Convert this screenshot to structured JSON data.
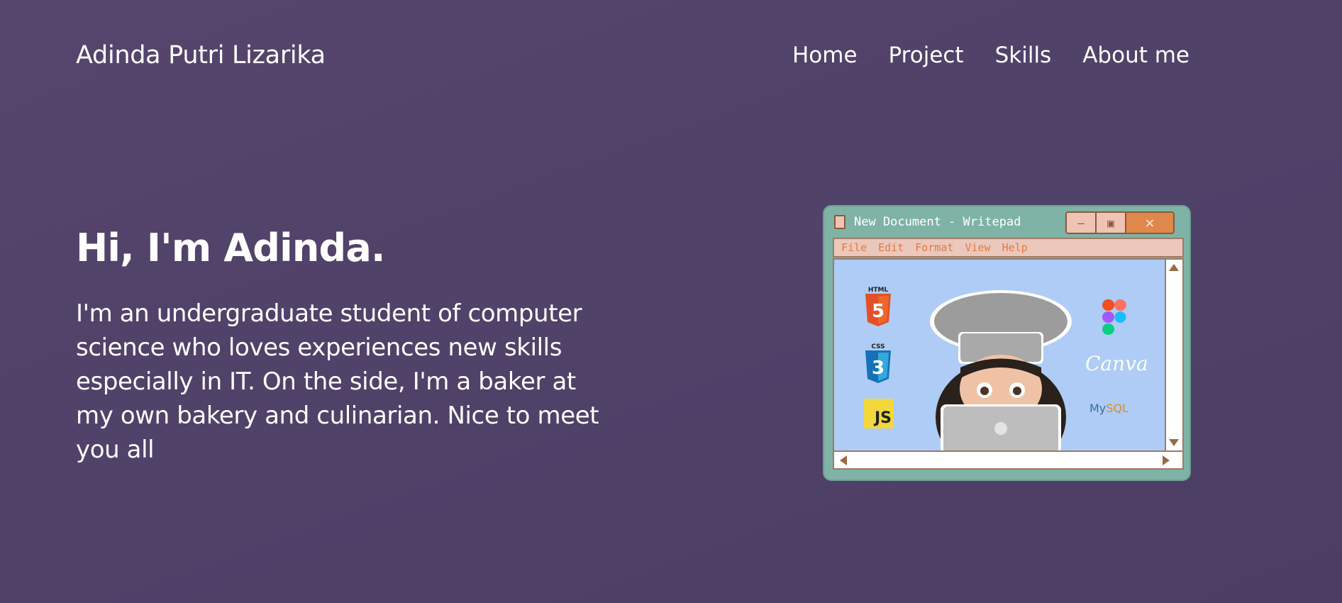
{
  "header": {
    "brand": "Adinda Putri Lizarika",
    "nav": [
      "Home",
      "Project",
      "Skills",
      "About me"
    ]
  },
  "hero": {
    "title": "Hi, I'm Adinda.",
    "text": "I'm an undergraduate student of computer science who loves experiences new skills especially in IT. On the side, I'm a baker at my own bakery and culinarian. Nice to meet you all"
  },
  "writepad": {
    "title": "New Document - Writepad",
    "menu": [
      "File",
      "Edit",
      "Format",
      "View",
      "Help"
    ],
    "controls": {
      "minimize": "—",
      "maximize": "▣",
      "close": "✕"
    },
    "logos": {
      "html": "HTML",
      "css": "CSS",
      "js": "JS",
      "canva": "Canva",
      "mysql_my": "My",
      "mysql_sql": "SQL"
    }
  },
  "colors": {
    "background": "#4f4168",
    "window_frame": "#7fb3a5",
    "menu_bar": "#ecc8bc",
    "menu_text": "#e07a44",
    "canvas": "#aeccf5",
    "close_button": "#e0874b"
  },
  "icons": [
    "document-icon",
    "minimize-icon",
    "maximize-icon",
    "close-icon",
    "html5-logo",
    "css3-logo",
    "js-logo",
    "figma-logo",
    "canva-logo",
    "mysql-logo",
    "chef-avatar"
  ]
}
